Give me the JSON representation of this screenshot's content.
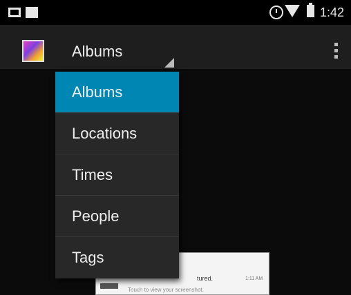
{
  "status_bar": {
    "time": "1:42",
    "icons": [
      "image-notification-icon",
      "square-notification-icon",
      "alarm-icon",
      "wifi-icon",
      "battery-icon"
    ]
  },
  "action_bar": {
    "title": "Albums",
    "app_icon": "gallery-app-icon",
    "overflow_icon": "overflow-menu-icon"
  },
  "dropdown": {
    "items": [
      {
        "label": "Albums",
        "selected": true
      },
      {
        "label": "Locations",
        "selected": false
      },
      {
        "label": "Times",
        "selected": false
      },
      {
        "label": "People",
        "selected": false
      },
      {
        "label": "Tags",
        "selected": false
      }
    ],
    "selected_color": "#0086b3"
  },
  "thumbnail": {
    "line1": "tured.",
    "time": "1:11 AM",
    "line2": "Touch to view your screenshot."
  }
}
